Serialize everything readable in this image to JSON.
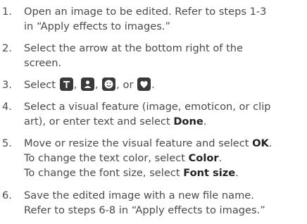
{
  "steps": [
    {
      "number": "1.",
      "lines": [
        "Open an image to be edited. Refer to steps 1-3",
        "in “Apply effects to images.”"
      ]
    },
    {
      "number": "2.",
      "lines": [
        "Select the arrow at the bottom right of the",
        "screen."
      ]
    },
    {
      "number": "3.",
      "prefix": "Select",
      "sep1": ",",
      "sep2": ",",
      "sep3": ", or",
      "suffix": ".",
      "icons": [
        "text-icon",
        "sticker-icon",
        "emoticon-icon",
        "frame-icon"
      ]
    },
    {
      "number": "4.",
      "line1": "Select a visual feature (image, emoticon, or clip",
      "line2_pre": "art), or enter text and select ",
      "line2_bold": "Done",
      "line2_post": "."
    },
    {
      "number": "5.",
      "line1_pre": "Move or resize the visual feature and select ",
      "line1_bold": "OK",
      "line1_post": ".",
      "line2_pre": "To change the text color, select ",
      "line2_bold": "Color",
      "line2_post": ".",
      "line3_pre": "To change the font size, select ",
      "line3_bold": "Font size",
      "line3_post": "."
    },
    {
      "number": "6.",
      "lines": [
        "Save the edited image with a new file name.",
        "Refer to steps 6-8 in “Apply effects to images.”"
      ]
    }
  ]
}
